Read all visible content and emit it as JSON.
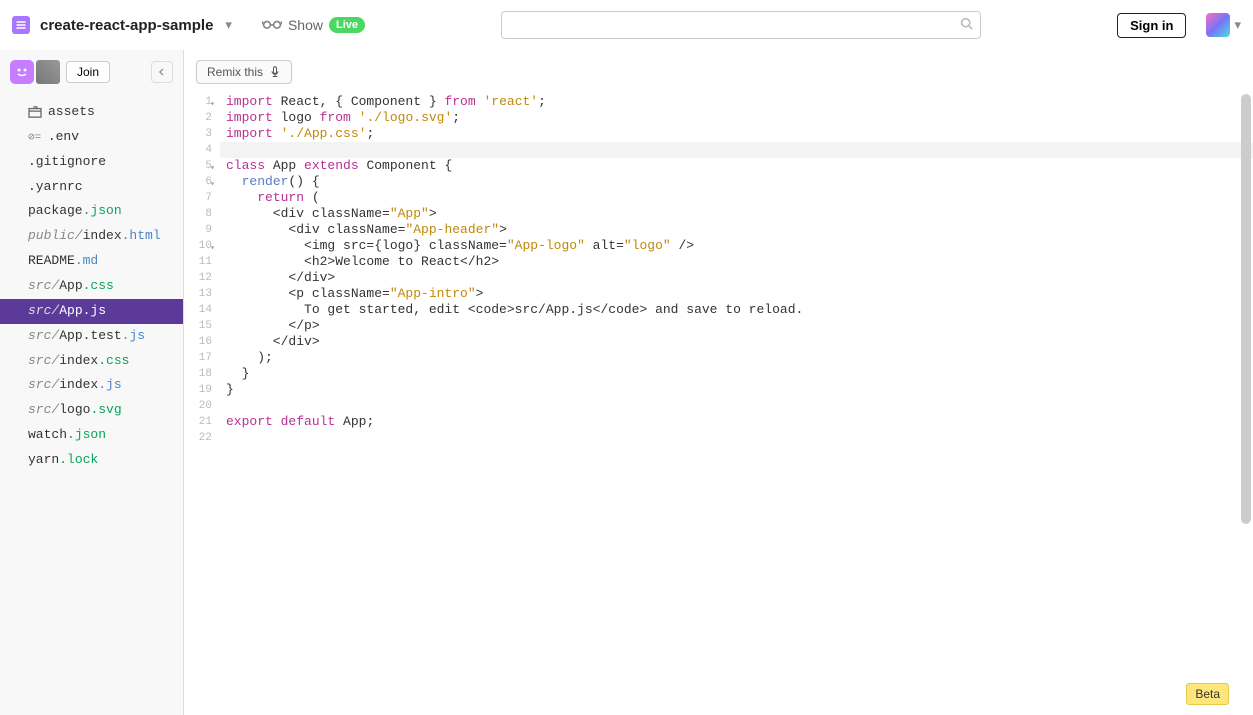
{
  "header": {
    "project_name": "create-react-app-sample",
    "show_label": "Show",
    "live_label": "Live",
    "search_placeholder": "",
    "signin_label": "Sign in"
  },
  "sidebar": {
    "join_label": "Join",
    "assets_label": "assets",
    "files": [
      {
        "dir": "",
        "name": ".env",
        "cls": "",
        "env": true
      },
      {
        "dir": "",
        "name": ".gitignore",
        "cls": ""
      },
      {
        "dir": "",
        "name": ".yarnrc",
        "cls": ""
      },
      {
        "dir": "",
        "name": "package",
        "ext": ".json",
        "cls": "ext-json"
      },
      {
        "dir": "public/",
        "name": "index",
        "ext": ".html",
        "cls": "ext-html"
      },
      {
        "dir": "",
        "name": "README",
        "ext": ".md",
        "cls": "ext-md"
      },
      {
        "dir": "src/",
        "name": "App",
        "ext": ".css",
        "cls": "ext-css"
      },
      {
        "dir": "src/",
        "name": "App",
        "ext": ".js",
        "cls": "ext-js",
        "active": true
      },
      {
        "dir": "src/",
        "name": "App.test",
        "ext": ".js",
        "cls": "ext-js"
      },
      {
        "dir": "src/",
        "name": "index",
        "ext": ".css",
        "cls": "ext-css"
      },
      {
        "dir": "src/",
        "name": "index",
        "ext": ".js",
        "cls": "ext-js"
      },
      {
        "dir": "src/",
        "name": "logo",
        "ext": ".svg",
        "cls": "ext-svg"
      },
      {
        "dir": "",
        "name": "watch",
        "ext": ".json",
        "cls": "ext-json"
      },
      {
        "dir": "",
        "name": "yarn",
        "ext": ".lock",
        "cls": "ext-lock"
      }
    ]
  },
  "toolbar": {
    "remix_label": "Remix this"
  },
  "code": {
    "cursor_line": 4,
    "fold_lines": [
      1,
      5,
      6,
      10
    ],
    "lines": [
      [
        {
          "t": "import",
          "c": "kw"
        },
        {
          "t": " React, { Component } ",
          "c": "plain"
        },
        {
          "t": "from",
          "c": "kw"
        },
        {
          "t": " ",
          "c": "plain"
        },
        {
          "t": "'react'",
          "c": "str"
        },
        {
          "t": ";",
          "c": "plain"
        }
      ],
      [
        {
          "t": "import",
          "c": "kw"
        },
        {
          "t": " logo ",
          "c": "plain"
        },
        {
          "t": "from",
          "c": "kw"
        },
        {
          "t": " ",
          "c": "plain"
        },
        {
          "t": "'./logo.svg'",
          "c": "str"
        },
        {
          "t": ";",
          "c": "plain"
        }
      ],
      [
        {
          "t": "import",
          "c": "kw"
        },
        {
          "t": " ",
          "c": "plain"
        },
        {
          "t": "'./App.css'",
          "c": "str"
        },
        {
          "t": ";",
          "c": "plain"
        }
      ],
      [],
      [
        {
          "t": "class",
          "c": "kw"
        },
        {
          "t": " App ",
          "c": "plain"
        },
        {
          "t": "extends",
          "c": "kw"
        },
        {
          "t": " Component {",
          "c": "plain"
        }
      ],
      [
        {
          "t": "  ",
          "c": "plain"
        },
        {
          "t": "render",
          "c": "fn"
        },
        {
          "t": "() {",
          "c": "plain"
        }
      ],
      [
        {
          "t": "    ",
          "c": "plain"
        },
        {
          "t": "return",
          "c": "kw"
        },
        {
          "t": " (",
          "c": "plain"
        }
      ],
      [
        {
          "t": "      <div className=",
          "c": "plain"
        },
        {
          "t": "\"App\"",
          "c": "str"
        },
        {
          "t": ">",
          "c": "plain"
        }
      ],
      [
        {
          "t": "        <div className=",
          "c": "plain"
        },
        {
          "t": "\"App-header\"",
          "c": "str"
        },
        {
          "t": ">",
          "c": "plain"
        }
      ],
      [
        {
          "t": "          <img src={logo} className=",
          "c": "plain"
        },
        {
          "t": "\"App-logo\"",
          "c": "str"
        },
        {
          "t": " alt=",
          "c": "plain"
        },
        {
          "t": "\"logo\"",
          "c": "str"
        },
        {
          "t": " />",
          "c": "plain"
        }
      ],
      [
        {
          "t": "          <h2>Welcome to React</h2>",
          "c": "plain"
        }
      ],
      [
        {
          "t": "        </div>",
          "c": "plain"
        }
      ],
      [
        {
          "t": "        <p className=",
          "c": "plain"
        },
        {
          "t": "\"App-intro\"",
          "c": "str"
        },
        {
          "t": ">",
          "c": "plain"
        }
      ],
      [
        {
          "t": "          To get started, edit <code>src/App.js</code> and save to reload.",
          "c": "plain"
        }
      ],
      [
        {
          "t": "        </p>",
          "c": "plain"
        }
      ],
      [
        {
          "t": "      </div>",
          "c": "plain"
        }
      ],
      [
        {
          "t": "    );",
          "c": "plain"
        }
      ],
      [
        {
          "t": "  }",
          "c": "plain"
        }
      ],
      [
        {
          "t": "}",
          "c": "plain"
        }
      ],
      [],
      [
        {
          "t": "export",
          "c": "kw"
        },
        {
          "t": " ",
          "c": "plain"
        },
        {
          "t": "default",
          "c": "kw"
        },
        {
          "t": " App;",
          "c": "plain"
        }
      ],
      []
    ]
  },
  "footer": {
    "beta_label": "Beta"
  }
}
